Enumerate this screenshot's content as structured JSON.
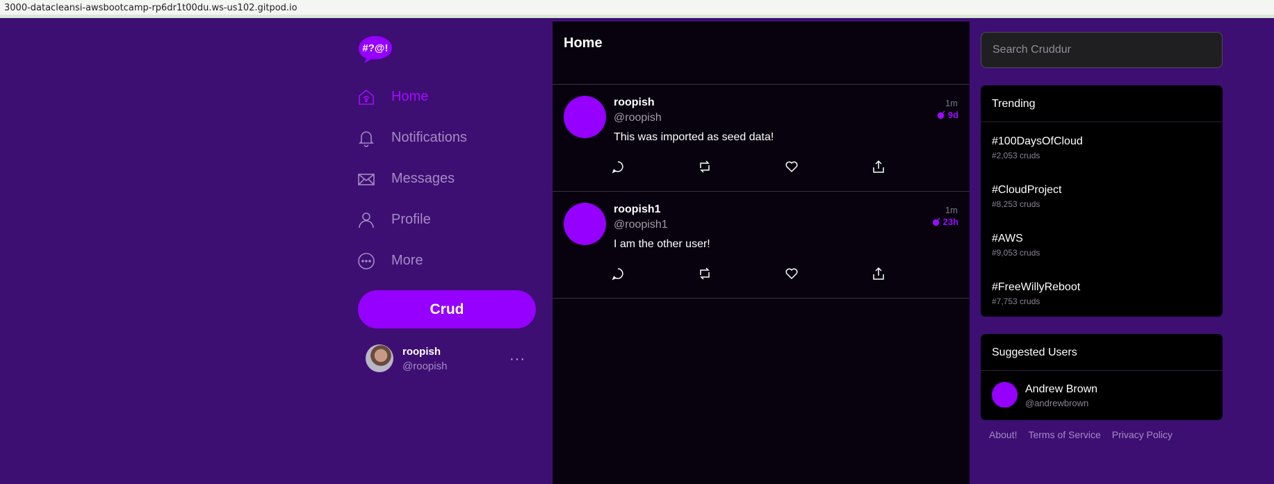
{
  "browser": {
    "url": "3000-datacleansi-awsbootcamp-rp6dr1t00du.ws-us102.gitpod.io"
  },
  "app": {
    "logo_text": "#?@!",
    "colors": {
      "accent": "#9500ff",
      "background": "#3d0f72",
      "feed_background": "#07020e"
    }
  },
  "nav": {
    "items": [
      {
        "label": "Home",
        "icon": "home-icon",
        "active": true
      },
      {
        "label": "Notifications",
        "icon": "bell-icon",
        "active": false
      },
      {
        "label": "Messages",
        "icon": "mail-icon",
        "active": false
      },
      {
        "label": "Profile",
        "icon": "person-icon",
        "active": false
      },
      {
        "label": "More",
        "icon": "more-circle-icon",
        "active": false
      }
    ],
    "crud_button": "Crud"
  },
  "current_user": {
    "name": "roopish",
    "handle": "@roopish",
    "menu": "···"
  },
  "feed": {
    "title": "Home",
    "posts": [
      {
        "name": "roopish",
        "handle": "@roopish",
        "message": "This was imported as seed data!",
        "time": "1m",
        "expires": "9d"
      },
      {
        "name": "roopish1",
        "handle": "@roopish1",
        "message": "I am the other user!",
        "time": "1m",
        "expires": "23h"
      }
    ]
  },
  "search": {
    "placeholder": "Search Cruddur"
  },
  "trending": {
    "title": "Trending",
    "items": [
      {
        "tag": "#100DaysOfCloud",
        "count": "#2,053 cruds"
      },
      {
        "tag": "#CloudProject",
        "count": "#8,253 cruds"
      },
      {
        "tag": "#AWS",
        "count": "#9,053 cruds"
      },
      {
        "tag": "#FreeWillyReboot",
        "count": "#7,753 cruds"
      }
    ]
  },
  "suggested": {
    "title": "Suggested Users",
    "users": [
      {
        "name": "Andrew Brown",
        "handle": "@andrewbrown"
      }
    ]
  },
  "footer": {
    "about": "About!",
    "terms": "Terms of Service",
    "privacy": "Privacy Policy"
  }
}
